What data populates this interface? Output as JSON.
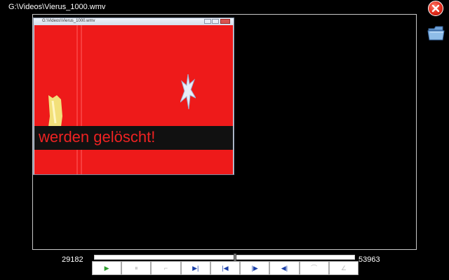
{
  "window": {
    "title": "G:\\Videos\\Vierus_1000.wmv"
  },
  "video_window": {
    "title": "G:\\Videos\\Vierus_1000.wmv"
  },
  "video": {
    "subtitle": "werden gelöscht!"
  },
  "timeline": {
    "current": "29182",
    "end": "53963",
    "progress": 0.54
  },
  "controls": [
    {
      "name": "play-button",
      "glyph": "▶",
      "color": "#2e9e2e"
    },
    {
      "name": "pause-button",
      "glyph": "⏸",
      "color": "#bbbbbb"
    },
    {
      "name": "mark-in-button",
      "glyph": "⌐",
      "color": "#bbbbbb"
    },
    {
      "name": "play-to-end-button",
      "glyph": "▶|",
      "color": "#1a3fa8"
    },
    {
      "name": "skip-back-button",
      "glyph": "|◀",
      "color": "#1a3fa8"
    },
    {
      "name": "skip-forward-button",
      "glyph": "|▶",
      "color": "#1a3fa8"
    },
    {
      "name": "step-back-button",
      "glyph": "◀|",
      "color": "#1a3fa8"
    },
    {
      "name": "mark-out-button",
      "glyph": "⌒",
      "color": "#bbbbbb"
    },
    {
      "name": "cut-button",
      "glyph": "∠",
      "color": "#bbbbbb"
    }
  ],
  "colors": {
    "background": "#000000",
    "video_red": "#ee1a1a",
    "subtitle_text": "#ee2222",
    "close_button": "#e02a1a"
  },
  "icons": [
    "close-icon",
    "folder-icon"
  ]
}
